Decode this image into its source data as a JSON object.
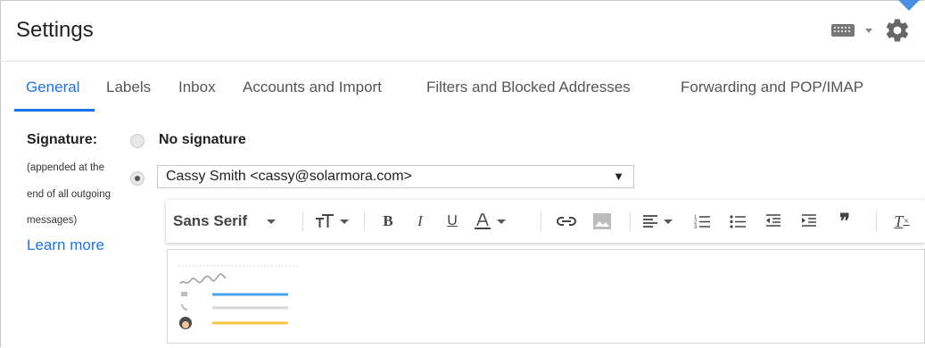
{
  "header": {
    "title": "Settings",
    "icons": [
      "keyboard-icon",
      "chevron-down-icon",
      "gear-icon"
    ]
  },
  "tabs": [
    {
      "label": "General",
      "active": true
    },
    {
      "label": "Labels"
    },
    {
      "label": "Inbox"
    },
    {
      "label": "Accounts and Import"
    },
    {
      "label": "Filters and Blocked Addresses"
    },
    {
      "label": "Forwarding and POP/IMAP"
    }
  ],
  "signature": {
    "label": "Signature:",
    "note_lines": [
      "(appended at the",
      "end of all outgoing",
      "messages)"
    ],
    "learn_more": "Learn more",
    "no_signature_label": "No signature",
    "selected_option": "Cassy Smith <cassy@solarmora.com>"
  },
  "toolbar": {
    "font_name": "Sans Serif",
    "buttons": [
      "font-size-icon",
      "bold-icon",
      "italic-icon",
      "underline-icon",
      "text-color-icon",
      "link-icon",
      "image-icon",
      "align-icon",
      "numbered-list-icon",
      "bulleted-list-icon",
      "indent-less-icon",
      "indent-more-icon",
      "quote-icon",
      "remove-formatting-icon"
    ]
  },
  "colors": {
    "accent": "#1a73e8",
    "illustration_blue": "#4aa3e8",
    "illustration_yellow": "#f6c744"
  }
}
